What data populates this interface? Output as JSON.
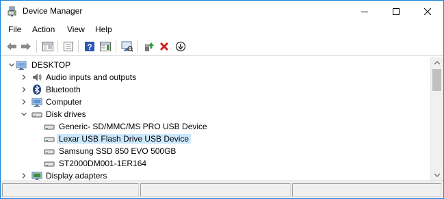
{
  "window": {
    "title": "Device Manager"
  },
  "menu": {
    "file": "File",
    "action": "Action",
    "view": "View",
    "help": "Help"
  },
  "toolbar": {
    "icons": [
      "back-arrow-icon",
      "forward-arrow-icon",
      "show-hide-console-tree-icon",
      "properties-icon",
      "help-icon",
      "show-action-pane-icon",
      "scan-hardware-icon",
      "update-driver-icon",
      "uninstall-device-icon",
      "disable-device-icon"
    ]
  },
  "tree": {
    "root": "DESKTOP",
    "items": [
      {
        "label": "Audio inputs and outputs",
        "icon": "speaker-icon",
        "expanded": false
      },
      {
        "label": "Bluetooth",
        "icon": "bluetooth-icon",
        "expanded": false
      },
      {
        "label": "Computer",
        "icon": "monitor-icon",
        "expanded": false
      },
      {
        "label": "Disk drives",
        "icon": "disk-drive-icon",
        "expanded": true,
        "children": [
          {
            "label": "Generic- SD/MMC/MS PRO USB Device",
            "icon": "disk-drive-icon"
          },
          {
            "label": "Lexar USB Flash Drive USB Device",
            "icon": "disk-drive-icon",
            "selected": true
          },
          {
            "label": "Samsung SSD 850 EVO 500GB",
            "icon": "disk-drive-icon"
          },
          {
            "label": "ST2000DM001-1ER164",
            "icon": "disk-drive-icon"
          }
        ]
      },
      {
        "label": "Display adapters",
        "icon": "display-adapter-icon",
        "expanded": false
      }
    ]
  },
  "colors": {
    "selection": "#cce8ff",
    "window_border": "#1883d7",
    "scrollbar_track": "#f0f0f0",
    "scrollbar_thumb": "#c1c1c1"
  }
}
